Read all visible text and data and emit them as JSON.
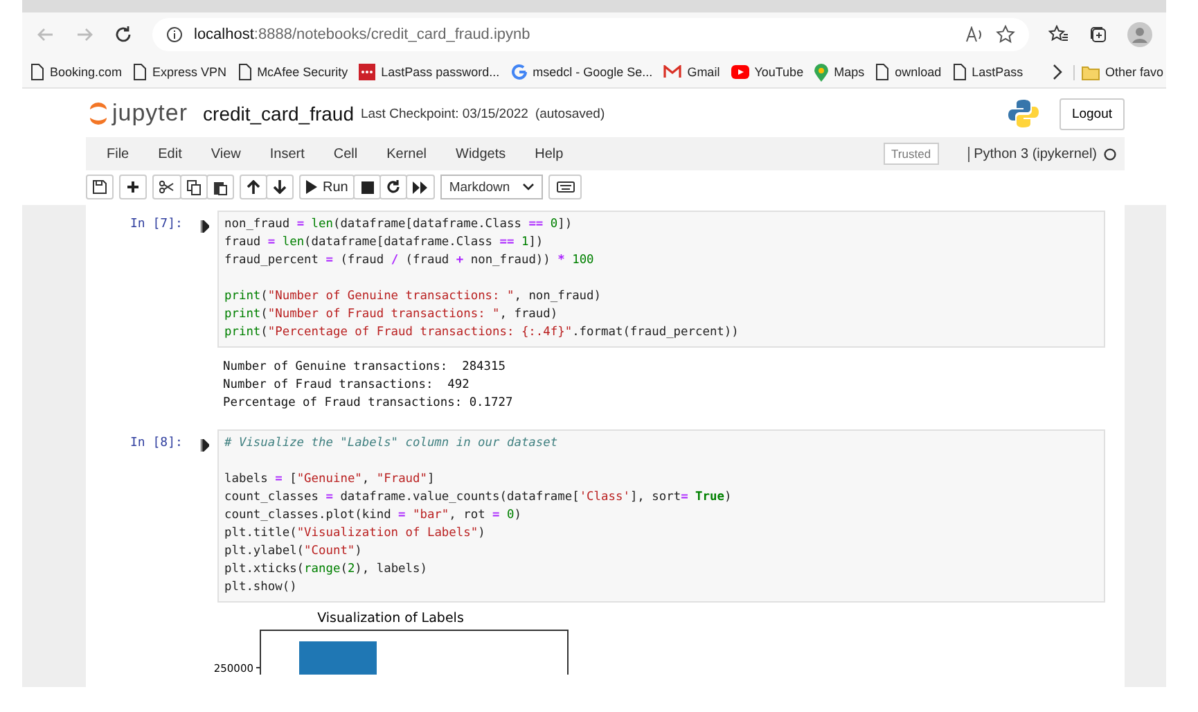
{
  "browser": {
    "url_host": "localhost",
    "url_path": ":8888/notebooks/credit_card_fraud.ipynb",
    "bookmarks": [
      {
        "label": "Booking.com",
        "kind": "page"
      },
      {
        "label": "Express VPN",
        "kind": "page"
      },
      {
        "label": "McAfee Security",
        "kind": "page"
      },
      {
        "label": "LastPass password...",
        "kind": "dots"
      },
      {
        "label": "msedcl - Google Se...",
        "kind": "g"
      },
      {
        "label": "Gmail",
        "kind": "envelope"
      },
      {
        "label": "YouTube",
        "kind": "play"
      },
      {
        "label": "Maps",
        "kind": "pin"
      },
      {
        "label": "ownload",
        "kind": "page"
      },
      {
        "label": "LastPass",
        "kind": "page"
      }
    ],
    "other_favorites": "Other favo"
  },
  "header": {
    "logo": "jupyter",
    "notebook_name": "credit_card_fraud",
    "checkpoint": "Last Checkpoint: 03/15/2022",
    "autosave": "(autosaved)",
    "logout": "Logout"
  },
  "menu": {
    "items": [
      "File",
      "Edit",
      "View",
      "Insert",
      "Cell",
      "Kernel",
      "Widgets",
      "Help"
    ],
    "trusted": "Trusted",
    "kernel": "Python 3 (ipykernel)"
  },
  "toolbar": {
    "run": "Run",
    "cell_type": "Markdown"
  },
  "cells": [
    {
      "prompt": "In [7]:",
      "blocks": [
        [
          [
            {
              "text": "non_fraud ",
              "kind": "plain"
            },
            {
              "text": "=",
              "kind": "op"
            },
            {
              "text": " len",
              "kind": "builtin"
            },
            {
              "text": "(dataframe[dataframe.Class ",
              "kind": "plain"
            },
            {
              "text": "==",
              "kind": "op"
            },
            {
              "text": " 0",
              "kind": "num"
            },
            {
              "text": "])",
              "kind": "plain"
            }
          ],
          [
            {
              "text": "fraud ",
              "kind": "plain"
            },
            {
              "text": "=",
              "kind": "op"
            },
            {
              "text": " len",
              "kind": "builtin"
            },
            {
              "text": "(dataframe[dataframe.Class ",
              "kind": "plain"
            },
            {
              "text": "==",
              "kind": "op"
            },
            {
              "text": " 1",
              "kind": "num"
            },
            {
              "text": "])",
              "kind": "plain"
            }
          ],
          [
            {
              "text": "fraud_percent ",
              "kind": "plain"
            },
            {
              "text": "=",
              "kind": "op"
            },
            {
              "text": " (fraud ",
              "kind": "plain"
            },
            {
              "text": "/",
              "kind": "op"
            },
            {
              "text": " (fraud ",
              "kind": "plain"
            },
            {
              "text": "+",
              "kind": "op"
            },
            {
              "text": " non_fraud)) ",
              "kind": "plain"
            },
            {
              "text": "*",
              "kind": "op"
            },
            {
              "text": " 100",
              "kind": "num"
            }
          ]
        ],
        [
          [
            {
              "text": "print",
              "kind": "builtin"
            },
            {
              "text": "(",
              "kind": "plain"
            },
            {
              "text": "\"Number of Genuine transactions: \"",
              "kind": "str"
            },
            {
              "text": ", non_fraud)",
              "kind": "plain"
            }
          ],
          [
            {
              "text": "print",
              "kind": "builtin"
            },
            {
              "text": "(",
              "kind": "plain"
            },
            {
              "text": "\"Number of Fraud transactions: \"",
              "kind": "str"
            },
            {
              "text": ", fraud)",
              "kind": "plain"
            }
          ],
          [
            {
              "text": "print",
              "kind": "builtin"
            },
            {
              "text": "(",
              "kind": "plain"
            },
            {
              "text": "\"Percentage of Fraud transactions: {:.4f}\"",
              "kind": "str"
            },
            {
              "text": ".format(fraud_percent))",
              "kind": "plain"
            }
          ]
        ]
      ],
      "output": [
        "Number of Genuine transactions:  284315",
        "Number of Fraud transactions:  492",
        "Percentage of Fraud transactions: 0.1727"
      ]
    },
    {
      "prompt": "In [8]:",
      "blocks": [
        [
          [
            {
              "text": "# Visualize the \"Labels\" column in our dataset",
              "kind": "comment"
            }
          ]
        ],
        [
          [
            {
              "text": "labels ",
              "kind": "plain"
            },
            {
              "text": "=",
              "kind": "op"
            },
            {
              "text": " [",
              "kind": "plain"
            },
            {
              "text": "\"Genuine\"",
              "kind": "str"
            },
            {
              "text": ", ",
              "kind": "plain"
            },
            {
              "text": "\"Fraud\"",
              "kind": "str"
            },
            {
              "text": "]",
              "kind": "plain"
            }
          ],
          [
            {
              "text": "count_classes ",
              "kind": "plain"
            },
            {
              "text": "=",
              "kind": "op"
            },
            {
              "text": " dataframe.value_counts(dataframe[",
              "kind": "plain"
            },
            {
              "text": "'Class'",
              "kind": "str"
            },
            {
              "text": "], sort",
              "kind": "plain"
            },
            {
              "text": "=",
              "kind": "op"
            },
            {
              "text": " True",
              "kind": "keyword"
            },
            {
              "text": ")",
              "kind": "plain"
            }
          ],
          [
            {
              "text": "count_classes.plot(kind ",
              "kind": "plain"
            },
            {
              "text": "=",
              "kind": "op"
            },
            {
              "text": " \"bar\"",
              "kind": "str"
            },
            {
              "text": ", rot ",
              "kind": "plain"
            },
            {
              "text": "=",
              "kind": "op"
            },
            {
              "text": " 0",
              "kind": "num"
            },
            {
              "text": ")",
              "kind": "plain"
            }
          ],
          [
            {
              "text": "plt.title(",
              "kind": "plain"
            },
            {
              "text": "\"Visualization of Labels\"",
              "kind": "str"
            },
            {
              "text": ")",
              "kind": "plain"
            }
          ],
          [
            {
              "text": "plt.ylabel(",
              "kind": "plain"
            },
            {
              "text": "\"Count\"",
              "kind": "str"
            },
            {
              "text": ")",
              "kind": "plain"
            }
          ],
          [
            {
              "text": "plt.xticks(",
              "kind": "plain"
            },
            {
              "text": "range",
              "kind": "builtin"
            },
            {
              "text": "(",
              "kind": "plain"
            },
            {
              "text": "2",
              "kind": "num"
            },
            {
              "text": "), labels)",
              "kind": "plain"
            }
          ],
          [
            {
              "text": "plt.show()",
              "kind": "plain"
            }
          ]
        ]
      ],
      "figure": {
        "title": "Visualization of Labels",
        "ytick": "250000"
      }
    }
  ]
}
